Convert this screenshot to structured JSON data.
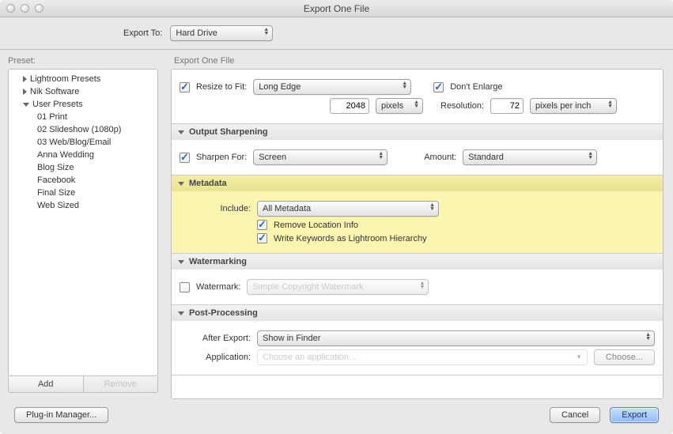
{
  "window": {
    "title": "Export One File"
  },
  "topbar": {
    "export_to_label": "Export To:",
    "export_to_value": "Hard Drive"
  },
  "preset": {
    "header": "Preset:",
    "groups": [
      {
        "label": "Lightroom Presets",
        "expanded": false,
        "children": []
      },
      {
        "label": "Nik Software",
        "expanded": false,
        "children": []
      },
      {
        "label": "User Presets",
        "expanded": true,
        "children": [
          "01 Print",
          "02 Slideshow (1080p)",
          "03 Web/Blog/Email",
          "Anna Wedding",
          "Blog Size",
          "Facebook",
          "Final Size",
          "Web Sized"
        ]
      }
    ],
    "add_label": "Add",
    "remove_label": "Remove"
  },
  "settings": {
    "header": "Export One File",
    "image_sizing": {
      "resize_label": "Resize to Fit:",
      "resize_checked": true,
      "mode_value": "Long Edge",
      "dont_enlarge_label": "Don't Enlarge",
      "dont_enlarge_checked": true,
      "dimension_value": "2048",
      "dimension_unit": "pixels",
      "resolution_label": "Resolution:",
      "resolution_value": "72",
      "resolution_unit": "pixels per inch"
    },
    "sharpening": {
      "title": "Output Sharpening",
      "sharpen_for_label": "Sharpen For:",
      "sharpen_for_checked": true,
      "sharpen_for_value": "Screen",
      "amount_label": "Amount:",
      "amount_value": "Standard"
    },
    "metadata": {
      "title": "Metadata",
      "include_label": "Include:",
      "include_value": "All Metadata",
      "remove_location_label": "Remove Location Info",
      "remove_location_checked": true,
      "write_hierarchy_label": "Write Keywords as Lightroom Hierarchy",
      "write_hierarchy_checked": true
    },
    "watermarking": {
      "title": "Watermarking",
      "watermark_label": "Watermark:",
      "watermark_checked": false,
      "watermark_value": "Simple Copyright Watermark"
    },
    "postprocessing": {
      "title": "Post-Processing",
      "after_export_label": "After Export:",
      "after_export_value": "Show in Finder",
      "application_label": "Application:",
      "application_placeholder": "Choose an application...",
      "choose_label": "Choose..."
    }
  },
  "footer": {
    "plugin_mgr_label": "Plug-in Manager...",
    "cancel_label": "Cancel",
    "export_label": "Export"
  }
}
